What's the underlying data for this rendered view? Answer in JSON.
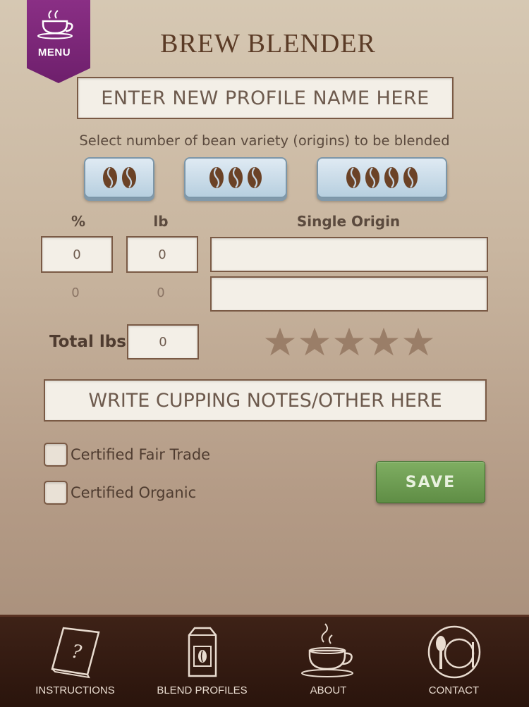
{
  "menu": {
    "label": "MENU",
    "icon": "coffee-cup-icon"
  },
  "app_title": "BREW BLENDER",
  "profile_name": {
    "placeholder": "ENTER NEW PROFILE NAME HERE"
  },
  "bean_selector": {
    "instruction": "Select number of bean variety (origins) to be blended",
    "options": [
      {
        "count": 2,
        "icon": "coffee-bean-icon"
      },
      {
        "count": 3,
        "icon": "coffee-bean-icon"
      },
      {
        "count": 4,
        "icon": "coffee-bean-icon"
      }
    ]
  },
  "blend_table": {
    "headers": {
      "percent": "%",
      "lb": "lb",
      "origin": "Single Origin"
    },
    "rows": [
      {
        "percent": "0",
        "lb": "0",
        "origin": ""
      },
      {
        "percent": "0",
        "lb": "0",
        "origin": ""
      }
    ]
  },
  "total": {
    "label": "Total lbs",
    "value": "0"
  },
  "rating": {
    "stars": 5,
    "value": 0,
    "icon": "star-icon"
  },
  "notes": {
    "placeholder": "WRITE CUPPING NOTES/OTHER HERE"
  },
  "checkboxes": [
    {
      "label": "Certified Fair Trade",
      "checked": false
    },
    {
      "label": "Certified Organic",
      "checked": false
    }
  ],
  "save_label": "SAVE",
  "nav": [
    {
      "label": "INSTRUCTIONS",
      "icon": "instructions-book-icon"
    },
    {
      "label": "BLEND PROFILES",
      "icon": "coffee-bag-icon"
    },
    {
      "label": "ABOUT",
      "icon": "steaming-cup-icon"
    },
    {
      "label": "CONTACT",
      "icon": "plate-cutlery-icon"
    }
  ],
  "colors": {
    "accent": "#7a2a77",
    "save": "#6a9a4e",
    "bean": "#6b4226",
    "nav_bg": "#2e170e"
  }
}
